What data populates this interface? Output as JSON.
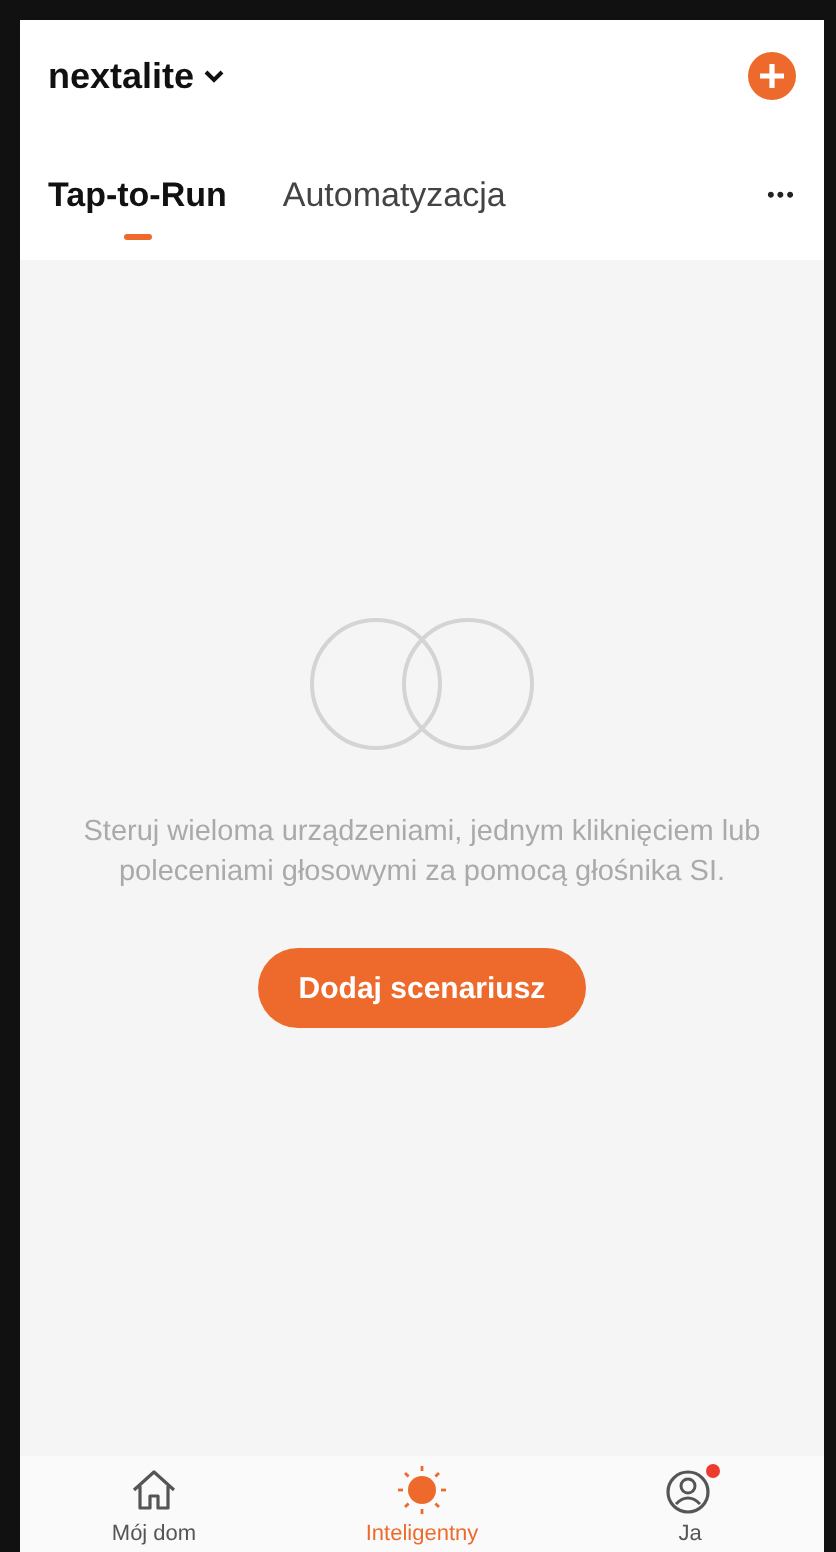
{
  "header": {
    "title": "nextalite"
  },
  "tabs": [
    {
      "label": "Tap-to-Run",
      "selected": true
    },
    {
      "label": "Automatyzacja",
      "selected": false
    }
  ],
  "more_menu": "•••",
  "empty_state": {
    "message": "Steruj wieloma urządzeniami, jednym kliknięciem lub poleceniami głosowymi za pomocą głośnika SI.",
    "button": "Dodaj scenariusz"
  },
  "bottom_nav": [
    {
      "kind": "home",
      "label": "Mój dom",
      "selected": false,
      "badge": false
    },
    {
      "kind": "smart",
      "label": "Inteligentny",
      "selected": true,
      "badge": false
    },
    {
      "kind": "profile",
      "label": "Ja",
      "selected": false,
      "badge": true
    }
  ]
}
